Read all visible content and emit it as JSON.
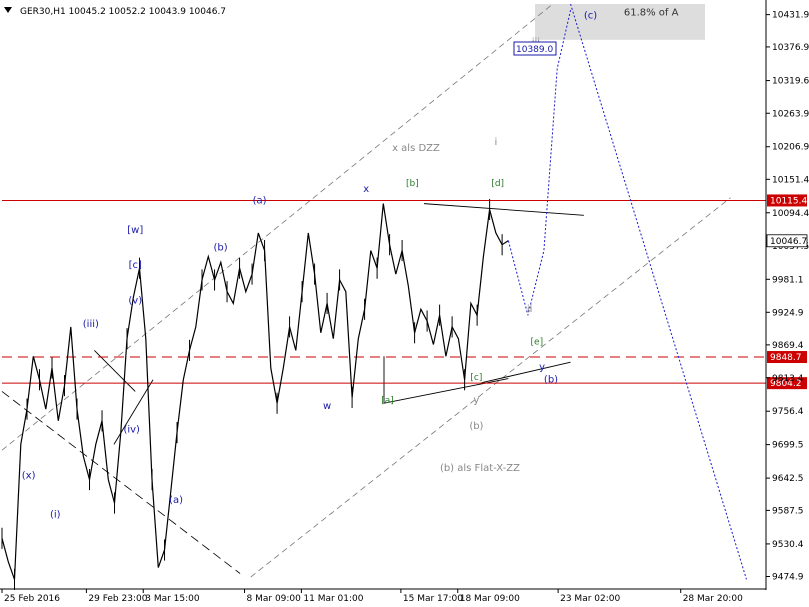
{
  "symbol_header": "GER30,H1  10045.2 10052.2 10043.9 10046.7",
  "colors": {
    "candle": "#000000",
    "wave_blue": "#1a1aaa",
    "wave_gray": "#888888",
    "wave_green": "#2a7a2a",
    "level_red": "#cc0000",
    "projection": "#1a1acc",
    "target_box": "#dddddd"
  },
  "target_box": {
    "label": "61.8% of A",
    "wave_label": "(c)",
    "price_from": 10389.0,
    "price_to": 10450
  },
  "chart_data": {
    "type": "candlestick",
    "title": "",
    "xlabel": "",
    "ylabel": "",
    "x_range_hours": [
      0,
      860
    ],
    "ylim": [
      9457,
      10450
    ],
    "grid": false,
    "y_ticks": [
      "10431.9",
      "10376.9",
      "10319.6",
      "10263.9",
      "10206.9",
      "10151.4",
      "10094.4",
      "10037.5",
      "9981.1",
      "9924.9",
      "9869.4",
      "9813.4",
      "9756.4",
      "9699.5",
      "9642.5",
      "9587.5",
      "9530.4",
      "9474.9"
    ],
    "x_ticks": [
      {
        "label": "25 Feb 2016",
        "hour": 0
      },
      {
        "label": "29 Feb 23:00",
        "hour": 95
      },
      {
        "label": "3 Mar 15:00",
        "hour": 159
      },
      {
        "label": "8 Mar 09:00",
        "hour": 273
      },
      {
        "label": "11 Mar 01:00",
        "hour": 337
      },
      {
        "label": "15 Mar 17:00",
        "hour": 449
      },
      {
        "label": "18 Mar 09:00",
        "hour": 513
      },
      {
        "label": "23 Mar 02:00",
        "hour": 626
      },
      {
        "label": "28 Mar 20:00",
        "hour": 764
      }
    ],
    "price_path": [
      [
        "25 Feb",
        9540
      ],
      [
        "",
        9500
      ],
      [
        "",
        9470
      ],
      [
        "",
        9700
      ],
      [
        "",
        9760
      ],
      [
        "",
        9850
      ],
      [
        "",
        9810
      ],
      [
        "",
        9760
      ],
      [
        "",
        9830
      ],
      [
        "",
        9740
      ],
      [
        "",
        9800
      ],
      [
        "",
        9900
      ],
      [
        "",
        9760
      ],
      [
        "",
        9680
      ],
      [
        "",
        9640
      ],
      [
        "",
        9700
      ],
      [
        "",
        9740
      ],
      [
        "",
        9640
      ],
      [
        "",
        9600
      ],
      [
        "",
        9720
      ],
      [
        "",
        9880
      ],
      [
        "",
        9950
      ],
      [
        "",
        10000
      ],
      [
        "",
        9880
      ],
      [
        "",
        9640
      ],
      [
        "",
        9490
      ],
      [
        "",
        9520
      ],
      [
        "",
        9620
      ],
      [
        "",
        9720
      ],
      [
        "",
        9810
      ],
      [
        "",
        9860
      ],
      [
        "",
        9900
      ],
      [
        "",
        9980
      ],
      [
        "",
        10020
      ],
      [
        "",
        9980
      ],
      [
        "",
        10010
      ],
      [
        "",
        9960
      ],
      [
        "",
        9940
      ],
      [
        "",
        10000
      ],
      [
        "",
        9960
      ],
      [
        "",
        9990
      ],
      [
        "",
        10060
      ],
      [
        "",
        10030
      ],
      [
        "",
        9830
      ],
      [
        "",
        9770
      ],
      [
        "",
        9830
      ],
      [
        "",
        9900
      ],
      [
        "",
        9860
      ],
      [
        "",
        9960
      ],
      [
        "",
        10060
      ],
      [
        "",
        9990
      ],
      [
        "",
        9890
      ],
      [
        "",
        9940
      ],
      [
        "",
        9880
      ],
      [
        "",
        9980
      ],
      [
        "",
        9960
      ],
      [
        "",
        9780
      ],
      [
        "",
        9880
      ],
      [
        "",
        9930
      ],
      [
        "",
        10030
      ],
      [
        "",
        10000
      ],
      [
        "",
        10110
      ],
      [
        "",
        10040
      ],
      [
        "",
        9990
      ],
      [
        "",
        10030
      ],
      [
        "",
        9970
      ],
      [
        "",
        9890
      ],
      [
        "",
        9930
      ],
      [
        "",
        9910
      ],
      [
        "",
        9870
      ],
      [
        "",
        9920
      ],
      [
        "",
        9850
      ],
      [
        "",
        9900
      ],
      [
        "",
        9880
      ],
      [
        "",
        9810
      ],
      [
        "",
        9940
      ],
      [
        "",
        9920
      ],
      [
        "",
        10020
      ],
      [
        "",
        10100
      ],
      [
        "",
        10060
      ],
      [
        "",
        10040
      ],
      [
        "",
        10047
      ]
    ],
    "projection_path": [
      [
        10046.7
      ],
      [
        9920
      ],
      [
        10030
      ],
      [
        10340
      ],
      [
        10440
      ]
    ],
    "falling_path": [
      [
        10450
      ],
      [
        9470
      ]
    ],
    "levels": [
      {
        "price": 10115.4,
        "label": "10115.4",
        "style": "solid"
      },
      {
        "price": 9848.7,
        "label": "9848.7",
        "style": "dashed"
      },
      {
        "price": 9804.2,
        "label": "9804.2",
        "style": "solid"
      }
    ],
    "current_price": {
      "price": 10046.7,
      "label": "10046.7"
    },
    "target_price_label": "10389.0",
    "wave_labels": [
      {
        "text": "(x)",
        "color": "blue",
        "hour": 30,
        "price": 9642
      },
      {
        "text": "(i)",
        "color": "blue",
        "hour": 60,
        "price": 9575
      },
      {
        "text": "(iii)",
        "color": "blue",
        "hour": 100,
        "price": 9900
      },
      {
        "text": "(iv)",
        "color": "blue",
        "hour": 146,
        "price": 9720
      },
      {
        "text": "(v)",
        "color": "blue",
        "hour": 150,
        "price": 9940
      },
      {
        "text": "[c]",
        "color": "blue",
        "hour": 150,
        "price": 10000
      },
      {
        "text": "[w]",
        "color": "blue",
        "hour": 150,
        "price": 10060
      },
      {
        "text": "(a)",
        "color": "blue",
        "hour": 196,
        "price": 9600
      },
      {
        "text": "(b)",
        "color": "blue",
        "hour": 246,
        "price": 10030
      },
      {
        "text": "(a)",
        "color": "blue",
        "hour": 290,
        "price": 10110
      },
      {
        "text": "w",
        "color": "blue",
        "hour": 366,
        "price": 9760
      },
      {
        "text": "x",
        "color": "blue",
        "hour": 410,
        "price": 10130
      },
      {
        "text": "x als DZZ",
        "color": "gray",
        "hour": 466,
        "price": 10200
      },
      {
        "text": "[b]",
        "color": "green",
        "hour": 462,
        "price": 10140
      },
      {
        "text": "[a]",
        "color": "green",
        "hour": 434,
        "price": 9770
      },
      {
        "text": "[c]",
        "color": "green",
        "hour": 534,
        "price": 9810
      },
      {
        "text": "y",
        "color": "gray",
        "hour": 534,
        "price": 9770
      },
      {
        "text": "(b)",
        "color": "gray",
        "hour": 534,
        "price": 9726
      },
      {
        "text": "(b) als Flat-X-ZZ",
        "color": "gray",
        "hour": 538,
        "price": 9655
      },
      {
        "text": "i",
        "color": "gray",
        "hour": 556,
        "price": 10210
      },
      {
        "text": "[d]",
        "color": "green",
        "hour": 558,
        "price": 10140
      },
      {
        "text": "ii",
        "color": "gray",
        "hour": 594,
        "price": 9925
      },
      {
        "text": "[e]",
        "color": "green",
        "hour": 602,
        "price": 9870
      },
      {
        "text": "y",
        "color": "blue",
        "hour": 608,
        "price": 9827
      },
      {
        "text": "(b)",
        "color": "blue",
        "hour": 618,
        "price": 9805
      },
      {
        "text": "iii",
        "color": "gray",
        "hour": 601,
        "price": 10380
      }
    ]
  }
}
